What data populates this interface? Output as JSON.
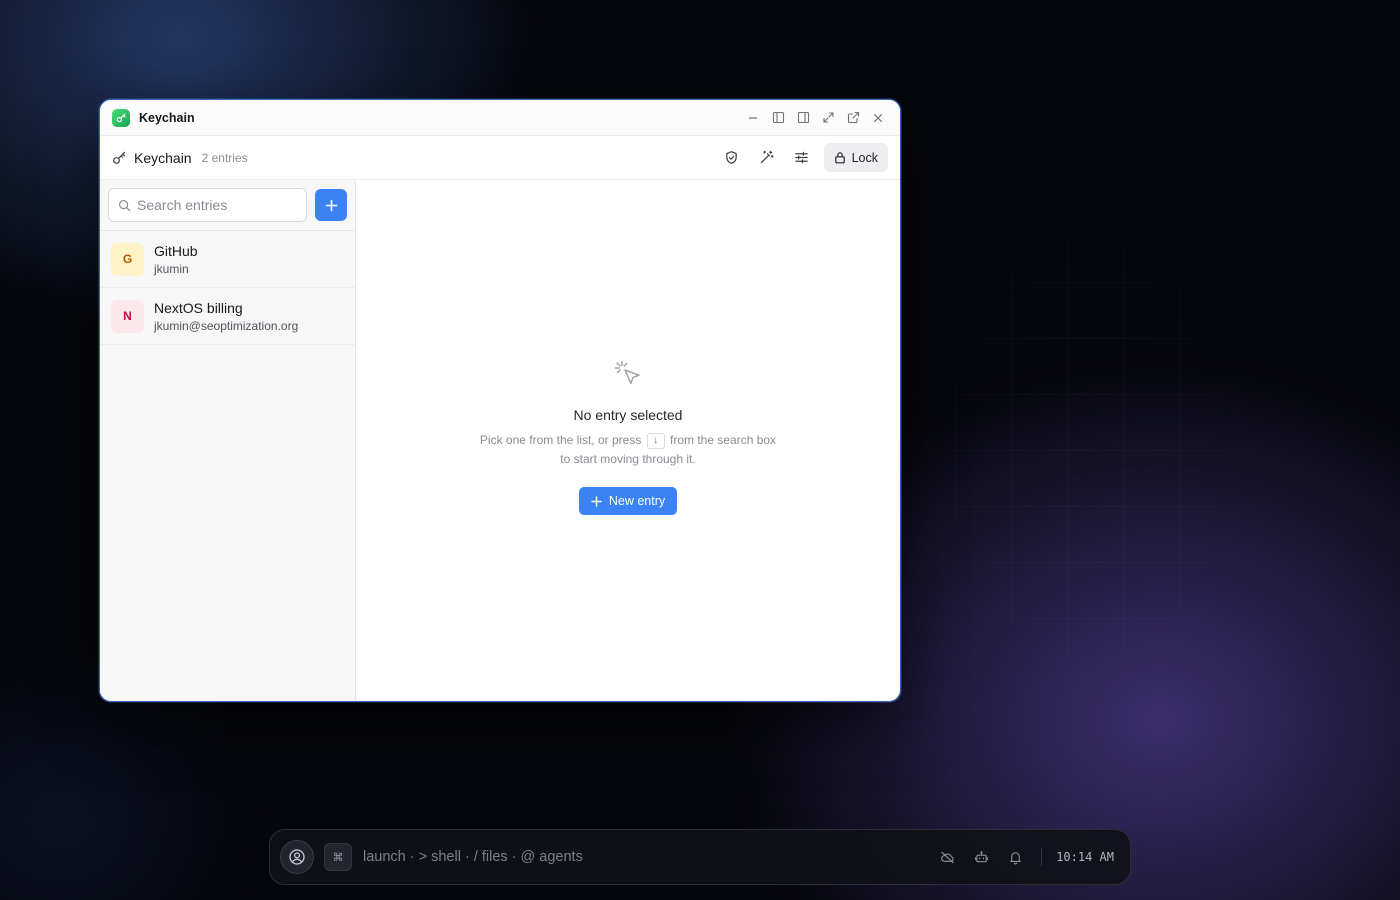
{
  "window": {
    "title": "Keychain",
    "controls": [
      "minimize",
      "sidebar-left",
      "sidebar-right",
      "maximize",
      "pop-out",
      "close"
    ]
  },
  "toolbar": {
    "title": "Keychain",
    "count": "2 entries",
    "lock_label": "Lock"
  },
  "sidebar": {
    "search_placeholder": "Search entries",
    "entries": [
      {
        "initial": "G",
        "name": "GitHub",
        "user": "jkumin",
        "color_bg": "#fef3c7",
        "color_fg": "#b45309"
      },
      {
        "initial": "N",
        "name": "NextOS billing",
        "user": "jkumin@seoptimization.org",
        "color_bg": "#fce7eb",
        "color_fg": "#be123c"
      }
    ]
  },
  "empty_state": {
    "title": "No entry selected",
    "desc_before": "Pick one from the list, or press",
    "key": "↓",
    "desc_after": "from the search box",
    "desc_line2": "to start moving through it.",
    "button_label": "New entry"
  },
  "dock": {
    "prompt": "launch · > shell · / files · @ agents",
    "cmd_key": "⌘",
    "time": "10:14 AM"
  },
  "colors": {
    "accent": "#3b82f6",
    "app_icon": "#22c55e",
    "window_border": "#3a64b8"
  }
}
